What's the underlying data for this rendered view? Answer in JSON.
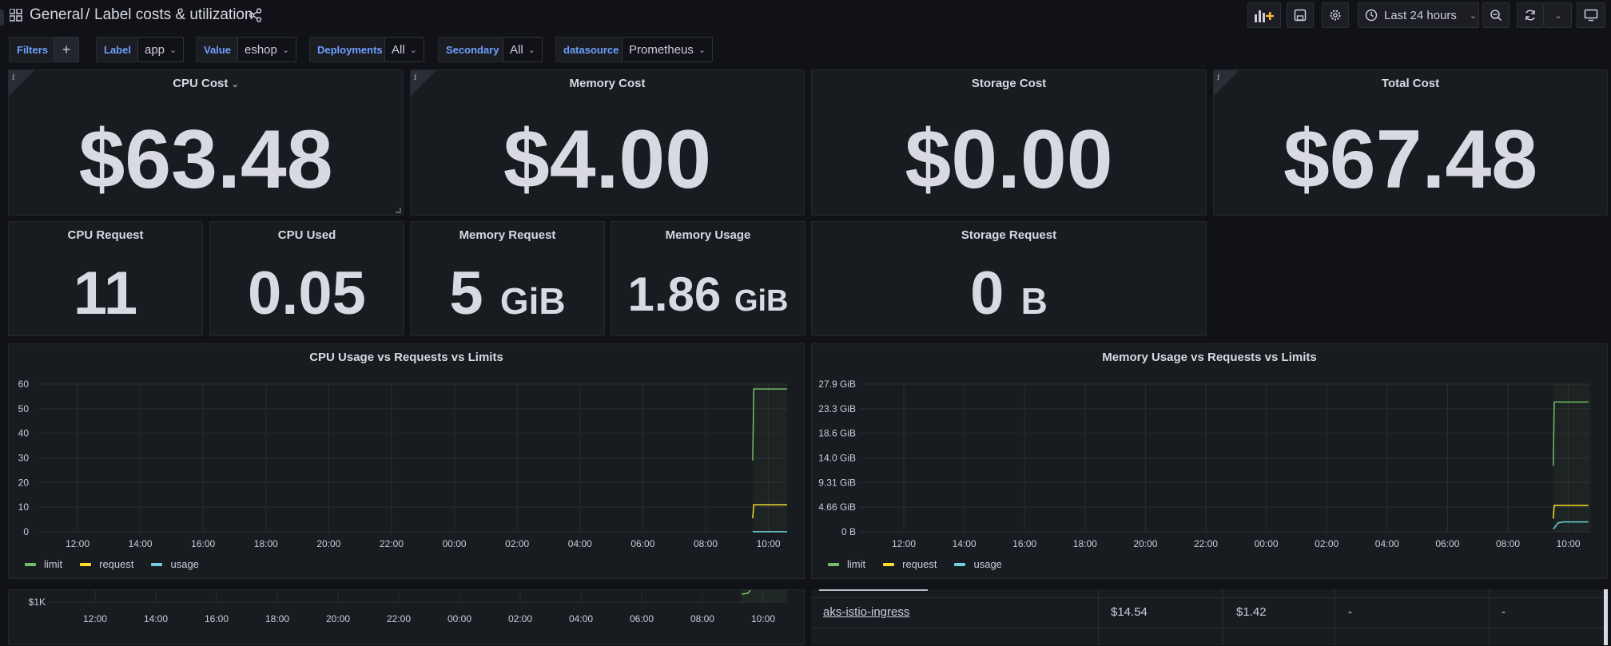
{
  "header": {
    "folder": "General",
    "separator": "/",
    "title": "Label costs & utilization",
    "time_range": "Last 24 hours"
  },
  "variables": {
    "filters_label": "Filters",
    "add_label": "+",
    "label": {
      "name": "Label",
      "value": "app"
    },
    "value": {
      "name": "Value",
      "value": "eshop"
    },
    "deployments": {
      "name": "Deployments",
      "value": "All"
    },
    "secondary": {
      "name": "Secondary",
      "value": "All"
    },
    "datasource": {
      "name": "datasource",
      "value": "Prometheus"
    }
  },
  "cost_panels": [
    {
      "title": "CPU Cost",
      "value": "$63.48"
    },
    {
      "title": "Memory Cost",
      "value": "$4.00"
    },
    {
      "title": "Storage Cost",
      "value": "$0.00"
    },
    {
      "title": "Total Cost",
      "value": "$67.48"
    }
  ],
  "stat_panels": [
    {
      "title": "CPU Request",
      "value": "11",
      "unit": ""
    },
    {
      "title": "CPU Used",
      "value": "0.05",
      "unit": ""
    },
    {
      "title": "Memory Request",
      "value": "5",
      "unit": "GiB"
    },
    {
      "title": "Memory Usage",
      "value": "1.86",
      "unit": "GiB"
    },
    {
      "title": "Storage Request",
      "value": "0",
      "unit": "B"
    }
  ],
  "colors": {
    "limit": "#73bf69",
    "request": "#fade2a",
    "usage": "#5794f2"
  },
  "chart_data": [
    {
      "type": "line",
      "title": "CPU Usage vs Requests vs Limits",
      "x_ticks": [
        "12:00",
        "14:00",
        "16:00",
        "18:00",
        "20:00",
        "22:00",
        "00:00",
        "02:00",
        "04:00",
        "06:00",
        "08:00",
        "10:00"
      ],
      "y_ticks": [
        "0",
        "10",
        "20",
        "30",
        "40",
        "50",
        "60"
      ],
      "ylim": [
        0,
        60
      ],
      "series": [
        {
          "name": "limit",
          "color": "#73bf69",
          "points": [
            [
              "09:30",
              29
            ],
            [
              "09:32",
              58
            ],
            [
              "10:40",
              58
            ]
          ]
        },
        {
          "name": "request",
          "color": "#fade2a",
          "points": [
            [
              "09:30",
              5.5
            ],
            [
              "09:32",
              11
            ],
            [
              "10:40",
              11
            ]
          ]
        },
        {
          "name": "usage",
          "color": "#6ed0e0",
          "points": [
            [
              "09:30",
              0.05
            ],
            [
              "10:40",
              0.05
            ]
          ]
        }
      ]
    },
    {
      "type": "line",
      "title": "Memory Usage vs Requests vs Limits",
      "x_ticks": [
        "12:00",
        "14:00",
        "16:00",
        "18:00",
        "20:00",
        "22:00",
        "00:00",
        "02:00",
        "04:00",
        "06:00",
        "08:00",
        "10:00"
      ],
      "y_ticks": [
        "0 B",
        "4.66 GiB",
        "9.31 GiB",
        "14.0 GiB",
        "18.6 GiB",
        "23.3 GiB",
        "27.9 GiB"
      ],
      "ylim": [
        0,
        27.9
      ],
      "series": [
        {
          "name": "limit",
          "color": "#73bf69",
          "points": [
            [
              "09:30",
              12.5
            ],
            [
              "09:32",
              24.5
            ],
            [
              "10:40",
              24.5
            ]
          ]
        },
        {
          "name": "request",
          "color": "#fade2a",
          "points": [
            [
              "09:30",
              2.5
            ],
            [
              "09:32",
              5
            ],
            [
              "10:40",
              5
            ]
          ]
        },
        {
          "name": "usage",
          "color": "#6ed0e0",
          "points": [
            [
              "09:30",
              0.5
            ],
            [
              "09:40",
              1.7
            ],
            [
              "09:50",
              1.86
            ],
            [
              "10:40",
              1.86
            ]
          ]
        }
      ]
    }
  ],
  "lower_chart": {
    "y_label": "$1K",
    "x_ticks": [
      "12:00",
      "14:00",
      "16:00",
      "18:00",
      "20:00",
      "22:00",
      "00:00",
      "02:00",
      "04:00",
      "06:00",
      "08:00",
      "10:00"
    ]
  },
  "table": {
    "row": {
      "name": "aks-istio-ingress",
      "c1": "$14.54",
      "c2": "$1.42",
      "c3": "-",
      "c4": "-"
    }
  }
}
